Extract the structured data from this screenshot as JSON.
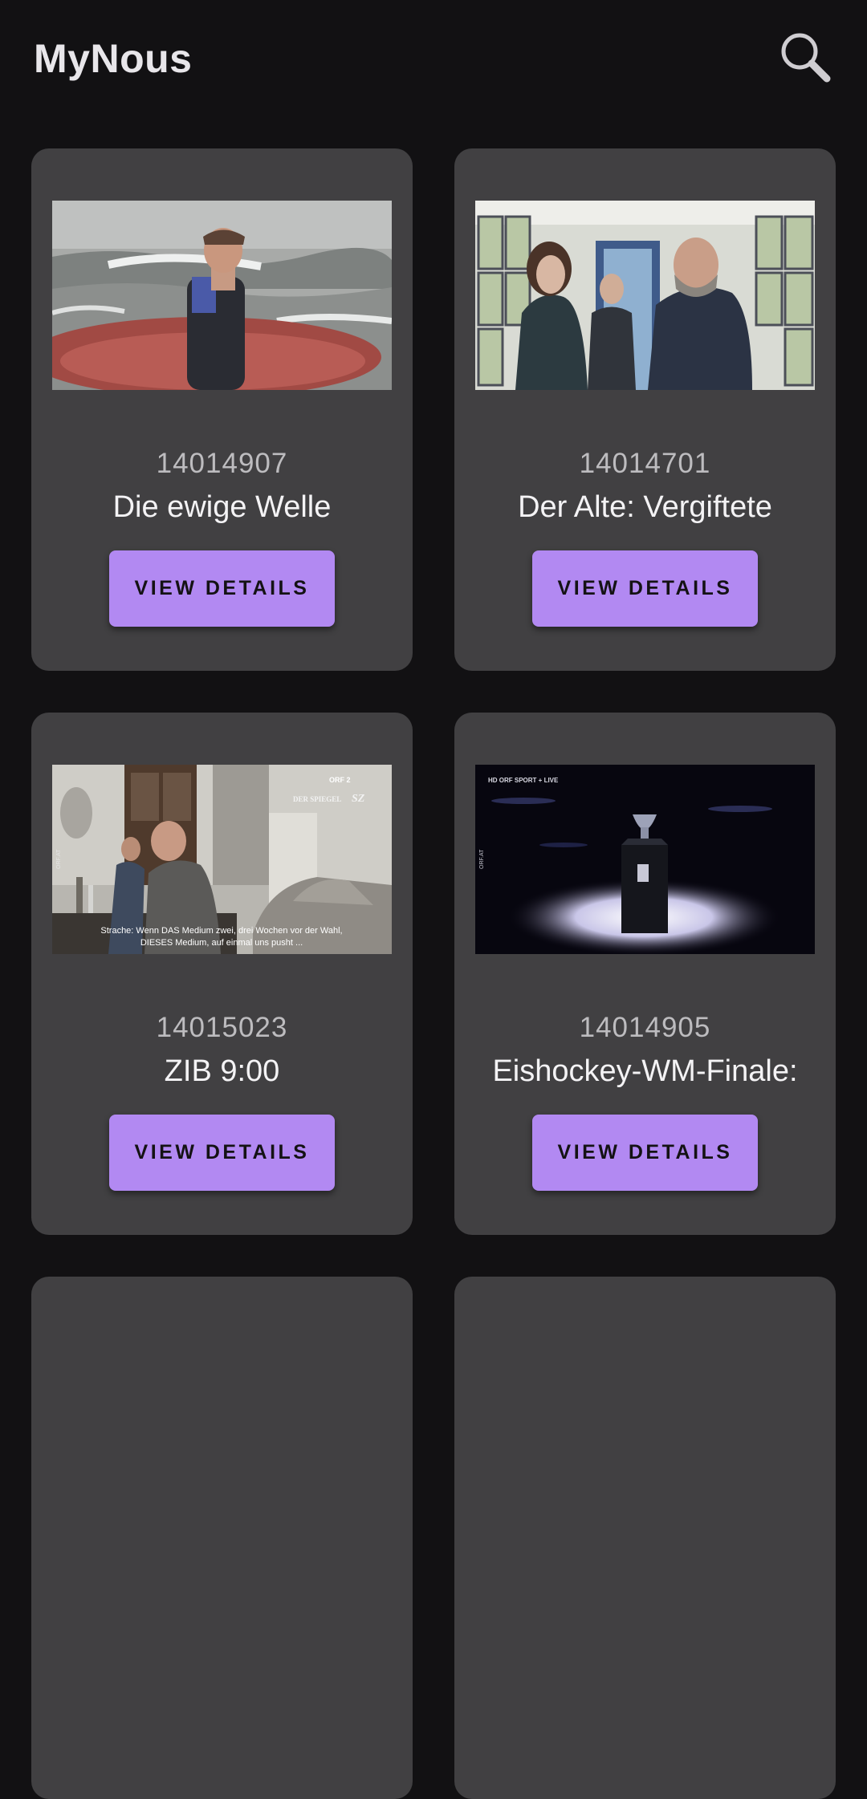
{
  "app": {
    "title": "MyNous",
    "search_icon": "search-icon"
  },
  "cards": [
    {
      "id": "14014907",
      "title": "Die ewige Welle",
      "button": "VIEW DETAILS"
    },
    {
      "id": "14014701",
      "title": "Der Alte: Vergiftete",
      "button": "VIEW DETAILS"
    },
    {
      "id": "14015023",
      "title": "ZIB 9:00",
      "button": "VIEW DETAILS",
      "thumb_text": {
        "watermark": "DER SPIEGEL",
        "logo": "SZ",
        "channel": "ORF 2",
        "side": "ORF.AT",
        "subtitle_1": "Strache: Wenn DAS Medium zwei, drei Wochen vor der Wahl,",
        "subtitle_2": "DIESES Medium, auf einmal uns pusht ..."
      }
    },
    {
      "id": "14014905",
      "title": "Eishockey-WM-Finale:",
      "button": "VIEW DETAILS",
      "thumb_text": {
        "channel": "HD ORF SPORT + LIVE",
        "side": "ORF.AT"
      }
    }
  ],
  "colors": {
    "background": "#121113",
    "card": "#414042",
    "accent": "#b289f2"
  }
}
